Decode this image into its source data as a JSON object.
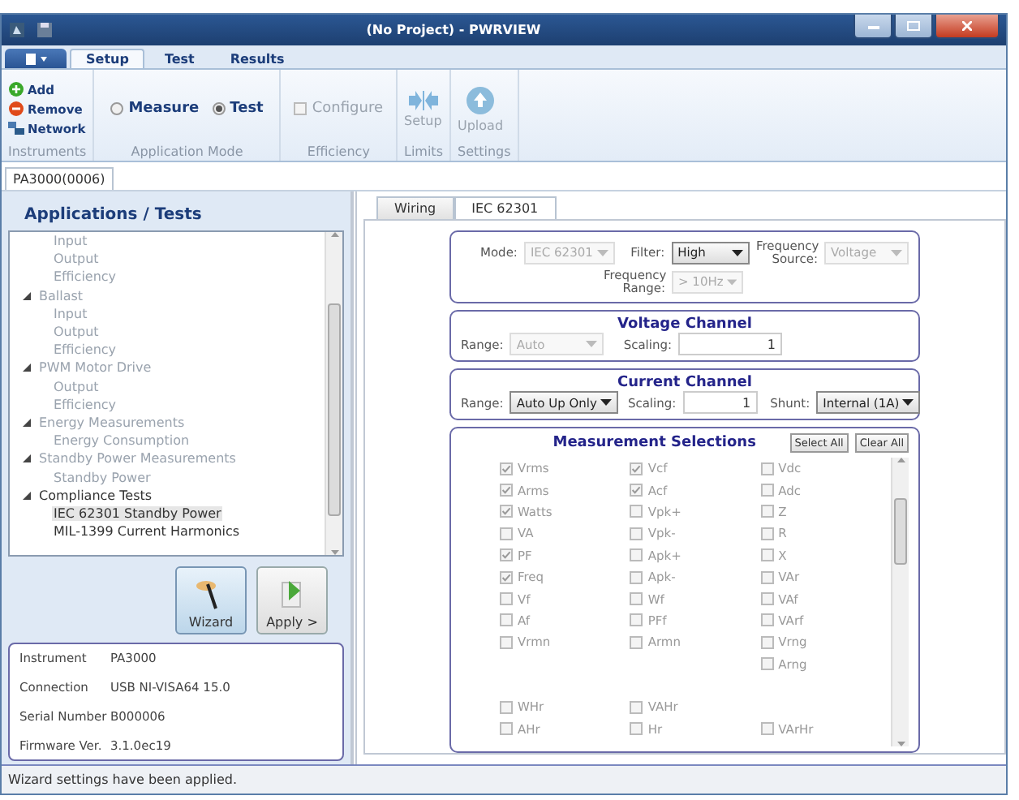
{
  "window": {
    "title": "(No Project) - PWRVIEW"
  },
  "ribbon_tabs": [
    {
      "label": "Setup",
      "selected": true
    },
    {
      "label": "Test",
      "selected": false
    },
    {
      "label": "Results",
      "selected": false
    }
  ],
  "ribbon": {
    "instruments": {
      "label": "Instruments",
      "add": "Add",
      "remove": "Remove",
      "network": "Network"
    },
    "mode": {
      "label": "Application Mode",
      "options": [
        {
          "label": "Measure",
          "selected": false
        },
        {
          "label": "Test",
          "selected": true
        }
      ]
    },
    "efficiency": {
      "label": "Efficiency",
      "configure": {
        "label": "Configure",
        "checked": false,
        "disabled": true
      }
    },
    "limits": {
      "label": "Limits",
      "setup": {
        "label": "Setup",
        "disabled": true
      }
    },
    "settings": {
      "label": "Settings",
      "upload": {
        "label": "Upload",
        "disabled": true
      }
    }
  },
  "doc_tabs": [
    {
      "label": "PA3000(0006)",
      "selected": true
    }
  ],
  "left": {
    "title": "Applications / Tests",
    "tree": [
      {
        "children": [
          {
            "label": "Input",
            "disabled": true,
            "selected": false
          },
          {
            "label": "Output",
            "disabled": true,
            "selected": false
          },
          {
            "label": "Efficiency",
            "disabled": true,
            "selected": false
          }
        ]
      },
      {
        "label": "Ballast",
        "disabled": true,
        "selected": false,
        "expanded": true,
        "children": [
          {
            "label": "Input",
            "disabled": true,
            "selected": false
          },
          {
            "label": "Output",
            "disabled": true,
            "selected": false
          },
          {
            "label": "Efficiency",
            "disabled": true,
            "selected": false
          }
        ]
      },
      {
        "label": "PWM Motor Drive",
        "disabled": true,
        "selected": false,
        "expanded": true,
        "children": [
          {
            "label": "Output",
            "disabled": true,
            "selected": false
          },
          {
            "label": "Efficiency",
            "disabled": true,
            "selected": false
          }
        ]
      },
      {
        "label": "Energy Measurements",
        "disabled": true,
        "selected": false,
        "expanded": true,
        "children": [
          {
            "label": "Energy Consumption",
            "disabled": true,
            "selected": false
          }
        ]
      },
      {
        "label": "Standby Power Measurements",
        "disabled": true,
        "selected": false,
        "expanded": true,
        "children": [
          {
            "label": "Standby Power",
            "disabled": true,
            "selected": false
          }
        ]
      },
      {
        "label": "Compliance Tests",
        "disabled": false,
        "selected": false,
        "expanded": true,
        "children": [
          {
            "label": "IEC 62301 Standby Power",
            "disabled": false,
            "selected": true
          },
          {
            "label": "MIL-1399 Current Harmonics",
            "disabled": false,
            "selected": false
          }
        ]
      }
    ],
    "wizard": "Wizard",
    "apply": "Apply >",
    "info": [
      {
        "label": "Instrument",
        "value": "PA3000"
      },
      {
        "label": "Connection",
        "value": "USB NI-VISA64 15.0"
      },
      {
        "label": "Serial Number",
        "value": "B000006"
      },
      {
        "label": "Firmware Ver.",
        "value": "3.1.0ec19"
      }
    ]
  },
  "right": {
    "tabs": [
      {
        "label": "Wiring",
        "selected": false
      },
      {
        "label": "IEC 62301",
        "selected": true
      }
    ],
    "mode": {
      "label": "Mode:",
      "value": "IEC 62301",
      "disabled": true
    },
    "filter": {
      "label": "Filter:",
      "value": "High",
      "disabled": false
    },
    "frequency_source": {
      "label": "Frequency Source:",
      "value": "Voltage",
      "disabled": true
    },
    "frequency_range": {
      "label": "Frequency Range:",
      "value": "> 10Hz",
      "disabled": true
    },
    "voltage": {
      "title": "Voltage Channel",
      "range": {
        "label": "Range:",
        "value": "Auto",
        "disabled": true
      },
      "scaling": {
        "label": "Scaling:",
        "value": "1"
      }
    },
    "current": {
      "title": "Current Channel",
      "range": {
        "label": "Range:",
        "value": "Auto Up Only",
        "disabled": false
      },
      "scaling": {
        "label": "Scaling:",
        "value": "1"
      },
      "shunt": {
        "label": "Shunt:",
        "value": "Internal (1A)",
        "disabled": false
      }
    },
    "measurements": {
      "title": "Measurement Selections",
      "select_all": "Select All",
      "clear_all": "Clear All",
      "rows": [
        [
          {
            "kind": "checkbox",
            "label": "Vrms",
            "checked": true
          },
          {
            "kind": "checkbox",
            "label": "Vcf",
            "checked": true
          },
          {
            "kind": "checkbox",
            "label": "Vdc",
            "checked": false
          }
        ],
        [
          {
            "kind": "checkbox",
            "label": "Arms",
            "checked": true
          },
          {
            "kind": "checkbox",
            "label": "Acf",
            "checked": true
          },
          {
            "kind": "checkbox",
            "label": "Adc",
            "checked": false
          }
        ],
        [
          {
            "kind": "checkbox",
            "label": "Watts",
            "checked": true
          },
          {
            "kind": "checkbox",
            "label": "Vpk+",
            "checked": false
          },
          {
            "kind": "checkbox",
            "label": "Z",
            "checked": false
          }
        ],
        [
          {
            "kind": "checkbox",
            "label": "VA",
            "checked": false
          },
          {
            "kind": "checkbox",
            "label": "Vpk-",
            "checked": false
          },
          {
            "kind": "checkbox",
            "label": "R",
            "checked": false
          }
        ],
        [
          {
            "kind": "checkbox",
            "label": "PF",
            "checked": true
          },
          {
            "kind": "checkbox",
            "label": "Apk+",
            "checked": false
          },
          {
            "kind": "checkbox",
            "label": "X",
            "checked": false
          }
        ],
        [
          {
            "kind": "checkbox",
            "label": "Freq",
            "checked": true
          },
          {
            "kind": "checkbox",
            "label": "Apk-",
            "checked": false
          },
          {
            "kind": "checkbox",
            "label": "VAr",
            "checked": false
          }
        ],
        [
          {
            "kind": "checkbox",
            "label": "Vf",
            "checked": false
          },
          {
            "kind": "checkbox",
            "label": "Wf",
            "checked": false
          },
          {
            "kind": "checkbox",
            "label": "VAf",
            "checked": false
          }
        ],
        [
          {
            "kind": "checkbox",
            "label": "Af",
            "checked": false
          },
          {
            "kind": "checkbox",
            "label": "PFf",
            "checked": false
          },
          {
            "kind": "checkbox",
            "label": "VArf",
            "checked": false
          }
        ],
        [
          {
            "kind": "checkbox",
            "label": "Vrmn",
            "checked": false
          },
          {
            "kind": "checkbox",
            "label": "Armn",
            "checked": false
          },
          {
            "kind": "checkbox",
            "label": "Vrng",
            "checked": false
          }
        ],
        [
          {
            "kind": "empty"
          },
          {
            "kind": "empty"
          },
          {
            "kind": "checkbox",
            "label": "Arng",
            "checked": false
          }
        ],
        [
          {
            "kind": "empty"
          },
          {
            "kind": "empty"
          },
          {
            "kind": "empty"
          }
        ],
        [
          {
            "kind": "checkbox",
            "label": "WHr",
            "checked": false
          },
          {
            "kind": "checkbox",
            "label": "VAHr",
            "checked": false
          },
          {
            "kind": "empty"
          }
        ],
        [
          {
            "kind": "checkbox",
            "label": "AHr",
            "checked": false
          },
          {
            "kind": "checkbox",
            "label": "Hr",
            "checked": false
          },
          {
            "kind": "checkbox",
            "label": "VArHr",
            "checked": false
          }
        ]
      ]
    }
  },
  "status_bar": "Wizard settings have been applied."
}
